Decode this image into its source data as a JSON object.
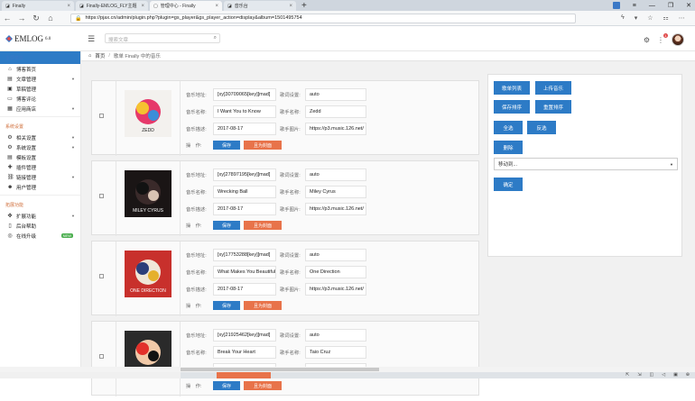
{
  "browser": {
    "tabs": [
      {
        "title": "Finally"
      },
      {
        "title": "Finally-EMLOG_FLY主题"
      },
      {
        "title": "管理中心 - Finally"
      },
      {
        "title": "音乐台"
      }
    ],
    "url": "https://pjax.cn/admin/plugin.php?plugin=gs_player&gs_player_action=display&album=1501495754"
  },
  "header": {
    "logo": "EMLOG",
    "version": "6.0",
    "search_placeholder": "搜索文章",
    "notify_count": "1"
  },
  "sidebar": {
    "sections": [
      {
        "title": "主要菜单",
        "items": [
          {
            "label": "博客首页",
            "icon": "home-icon"
          },
          {
            "label": "文章管理",
            "icon": "document-icon",
            "caret": true
          },
          {
            "label": "草稿管理",
            "icon": "draft-icon"
          },
          {
            "label": "博客评论",
            "icon": "comment-icon"
          },
          {
            "label": "应用商店",
            "icon": "store-icon",
            "caret": true
          }
        ]
      },
      {
        "title": "系统设置",
        "items": [
          {
            "label": "相关设置",
            "icon": "settings-icon",
            "caret": true
          },
          {
            "label": "系统设置",
            "icon": "system-icon",
            "caret": true
          },
          {
            "label": "模板设置",
            "icon": "template-icon"
          },
          {
            "label": "插件管理",
            "icon": "plugin-icon"
          },
          {
            "label": "链接管理",
            "icon": "link-icon",
            "caret": true
          },
          {
            "label": "用户管理",
            "icon": "users-icon"
          }
        ]
      },
      {
        "title": "拓展功能",
        "items": [
          {
            "label": "扩展功能",
            "icon": "puzzle-icon",
            "caret": true
          },
          {
            "label": "后台帮助",
            "icon": "help-icon"
          },
          {
            "label": "在线升级",
            "icon": "upgrade-icon",
            "badge": "NEW"
          }
        ]
      }
    ]
  },
  "breadcrumb": {
    "home": "首页",
    "current": "歌单 Finally 中的音乐"
  },
  "labels": {
    "url": "音乐地址:",
    "lyric": "歌词设置:",
    "name": "音乐名称:",
    "artist": "歌手名称:",
    "desc": "音乐描述:",
    "image": "歌手图片:",
    "op": "操　作:",
    "save": "保存",
    "cover_save": "且为封面"
  },
  "songs": [
    {
      "url": "[xy]30709065[key][mad]",
      "lyric": "auto",
      "name": "I Want You to Know",
      "artist": "Zedd",
      "desc": "2017-08-17",
      "image": "https://p3.music.126.net/"
    },
    {
      "url": "[xy]27897195[key][mad]",
      "lyric": "auto",
      "name": "Wrecking Ball",
      "artist": "Miley Cyrus",
      "desc": "2017-08-17",
      "image": "https://p3.music.126.net/"
    },
    {
      "url": "[xy]17753288[key][mad]",
      "lyric": "auto",
      "name": "What Makes You Beautiful",
      "artist": "One Direction",
      "desc": "2017-08-17",
      "image": "https://p3.music.126.net/"
    },
    {
      "url": "[xy]21925462[key][mad]",
      "lyric": "auto",
      "name": "Break Your Heart",
      "artist": "Taio Cruz",
      "desc": "2017-08-17",
      "image": "https://p3.music.126.net/"
    }
  ],
  "cover_art": [
    {
      "caption": "ZEDD"
    },
    {
      "caption": "MILEY CYRUS"
    },
    {
      "caption": "ONE DIRECTION"
    },
    {
      "caption": "TAIO CRUZ"
    }
  ],
  "panel": {
    "song_list": "歌单列表",
    "upload": "上传音乐",
    "save_order": "保存排序",
    "reset_order": "重置排序",
    "select_all": "全选",
    "invert": "反选",
    "delete": "删除",
    "move_to": "移动到...",
    "confirm": "确定"
  },
  "colors": {
    "accent_blue": "#2d7bc6",
    "accent_orange": "#e8734a",
    "section_orange": "#d0703d"
  }
}
